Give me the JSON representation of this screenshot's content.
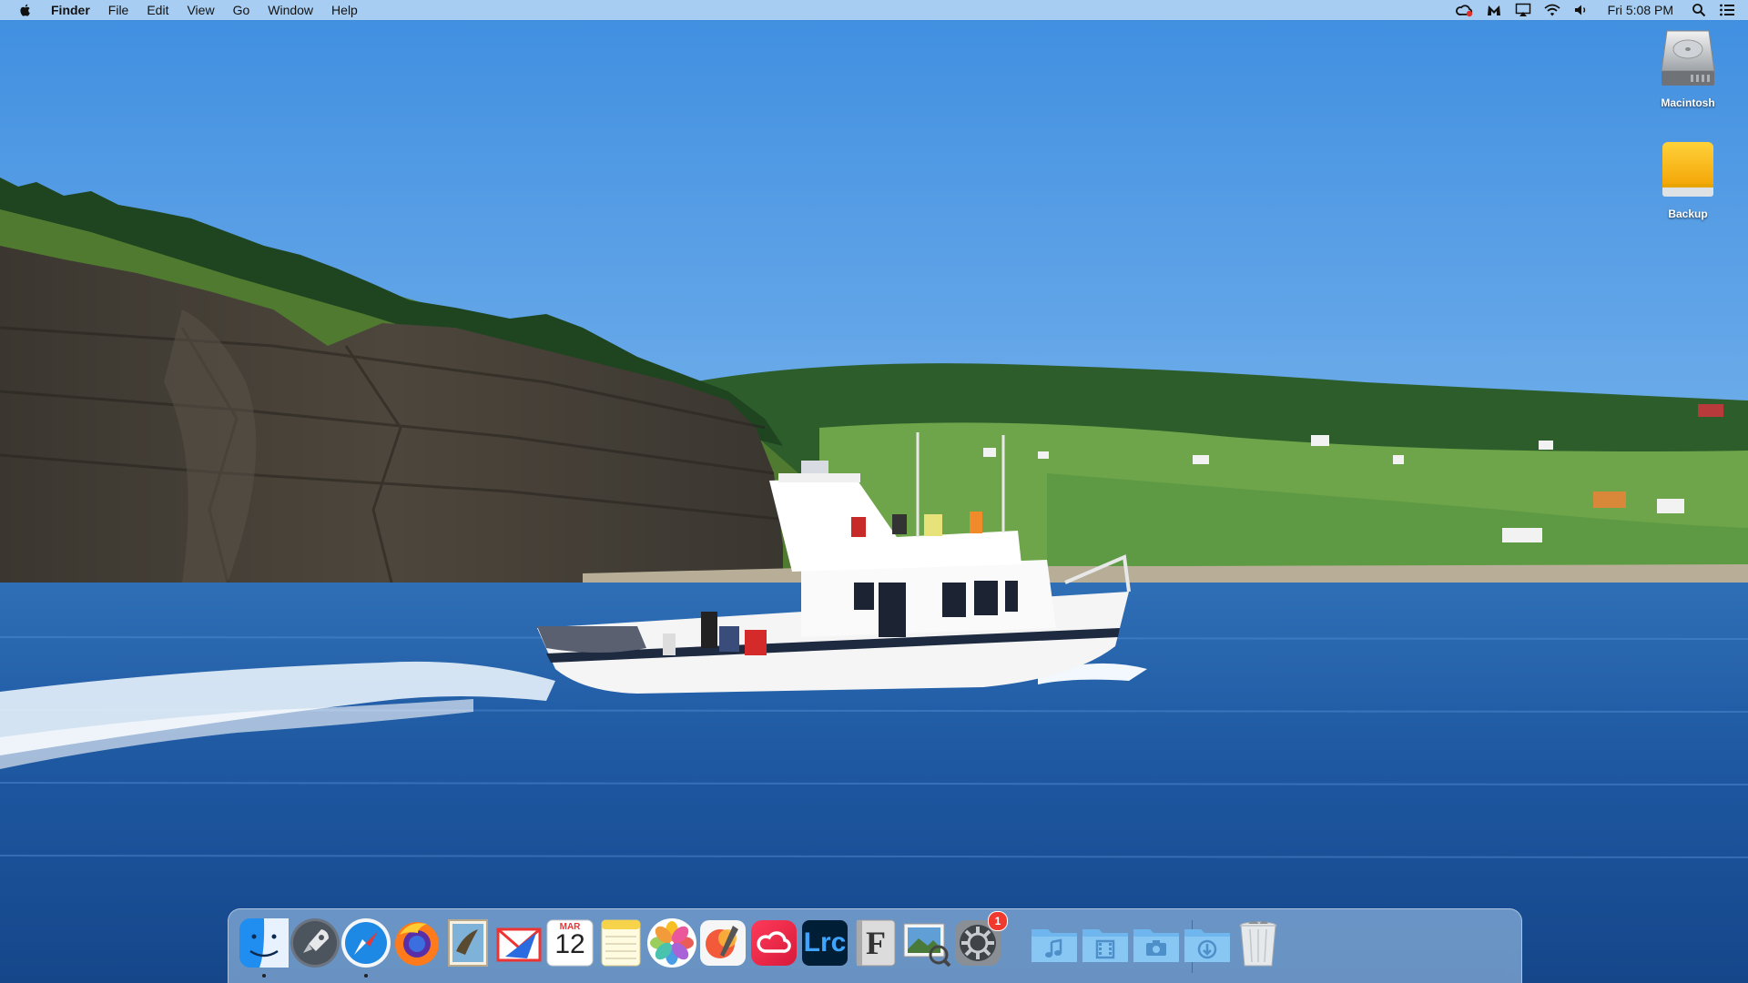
{
  "menubar": {
    "app_name": "Finder",
    "menus": [
      "File",
      "Edit",
      "View",
      "Go",
      "Window",
      "Help"
    ],
    "status_icons": [
      "creative-cloud-icon",
      "malwarebytes-icon",
      "airplay-icon",
      "wifi-icon",
      "volume-icon"
    ],
    "clock": "Fri 5:08 PM"
  },
  "desktop_icons": [
    {
      "label": "Macintosh",
      "icon": "hard-drive-icon"
    },
    {
      "label": "Backup",
      "icon": "external-drive-icon"
    }
  ],
  "dock": {
    "apps": [
      {
        "name": "Finder",
        "icon": "finder-icon",
        "running": true
      },
      {
        "name": "Launchpad",
        "icon": "launchpad-icon",
        "running": false
      },
      {
        "name": "Safari",
        "icon": "safari-icon",
        "running": true
      },
      {
        "name": "Firefox",
        "icon": "firefox-icon",
        "running": false
      },
      {
        "name": "Mail",
        "icon": "mail-icon",
        "running": false
      },
      {
        "name": "Airmail",
        "icon": "airmail-icon",
        "running": false
      },
      {
        "name": "Calendar",
        "icon": "calendar-icon",
        "running": false,
        "month": "MAR",
        "day": "12"
      },
      {
        "name": "Notes",
        "icon": "notes-icon",
        "running": false
      },
      {
        "name": "Photos",
        "icon": "photos-icon",
        "running": false
      },
      {
        "name": "Pixelmator",
        "icon": "pixelmator-icon",
        "running": false
      },
      {
        "name": "Creative Cloud",
        "icon": "creative-cloud-icon",
        "running": false
      },
      {
        "name": "Lightroom Classic",
        "icon": "lightroom-icon",
        "running": false,
        "text": "Lrc"
      },
      {
        "name": "Font Book",
        "icon": "fontbook-icon",
        "running": false,
        "text": "F"
      },
      {
        "name": "Preview",
        "icon": "preview-icon",
        "running": false
      },
      {
        "name": "System Preferences",
        "icon": "system-preferences-icon",
        "running": false,
        "badge": "1"
      }
    ],
    "folders": [
      {
        "name": "Music",
        "icon": "music-folder-icon"
      },
      {
        "name": "Movies",
        "icon": "movies-folder-icon"
      },
      {
        "name": "Pictures",
        "icon": "pictures-folder-icon"
      },
      {
        "name": "Downloads",
        "icon": "downloads-folder-icon"
      },
      {
        "name": "Trash",
        "icon": "trash-icon"
      }
    ]
  }
}
